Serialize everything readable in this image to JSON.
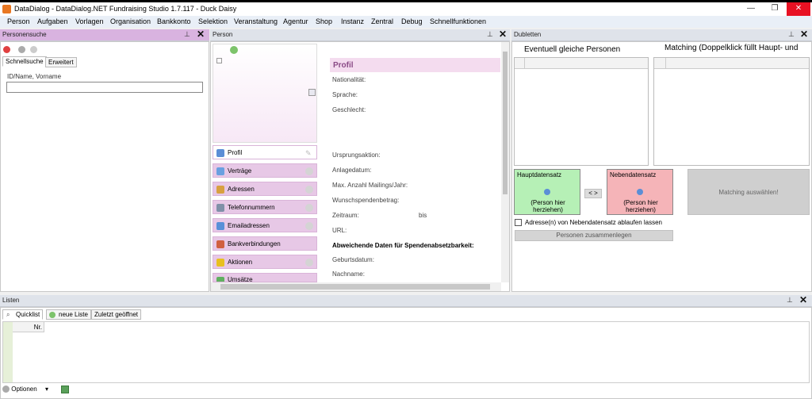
{
  "window": {
    "title": "DataDialog - DataDialog.NET Fundraising Studio 1.7.117 - Duck Daisy"
  },
  "menu": [
    "Person",
    "Aufgaben",
    "Vorlagen",
    "Organisation",
    "Bankkonto",
    "Selektion",
    "Veranstaltung",
    "Agentur",
    "Shop",
    "Instanz",
    "Zentral",
    "Debug",
    "Schnellfunktionen"
  ],
  "personensuche": {
    "title": "Personensuche",
    "tabs": [
      "Schnellsuche",
      "Erweitert"
    ],
    "field_label": "ID/Name, Vorname",
    "field_value": ""
  },
  "person": {
    "title": "Person",
    "section": "Profil",
    "nav": [
      "Profil",
      "Verträge",
      "Adressen",
      "Telefonnummern",
      "Emailadressen",
      "Bankverbindungen",
      "Aktionen",
      "Umsätze"
    ],
    "fields": [
      "Nationalität:",
      "Sprache:",
      "Geschlecht:",
      "Ursprungsaktion:",
      "Anlagedatum:",
      "Max. Anzahl Mailings/Jahr:",
      "Wunschspendenbetrag:",
      "Zeitraum:",
      "URL:",
      "Abweichende Daten für Spendenabsetzbarkeit:",
      "Geburtsdatum:",
      "Nachname:"
    ],
    "zeitraum_bis": "bis"
  },
  "dubletten": {
    "title": "Dubletten",
    "left_header": "Eventuell gleiche Personen",
    "right_header": "Matching (Doppelklick füllt Haupt- und",
    "haupt": {
      "title": "Hauptdatensatz",
      "drop": "(Person hier herziehen)"
    },
    "neben": {
      "title": "Nebendatensatz",
      "drop": "(Person hier herziehen)"
    },
    "swap": "< >",
    "matching_btn": "Matching auswählen!",
    "checkbox": "Adresse(n) von Nebendatensatz ablaufen lassen",
    "merge_btn": "Personen zusammenlegen"
  },
  "listen": {
    "title": "Listen",
    "tabs": [
      "Quicklist",
      "neue Liste",
      "Zuletzt geöffnet"
    ],
    "col": "Nr.",
    "optionen": "Optionen"
  },
  "colors": {
    "accent": "#d9b3e0",
    "close": "#e81123",
    "haupt": "#b6f0b6",
    "neben": "#f5b4b8"
  }
}
